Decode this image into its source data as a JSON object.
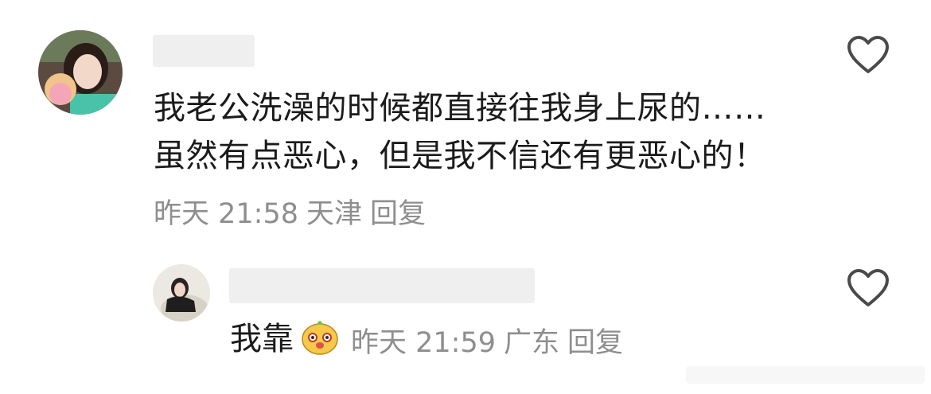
{
  "comment": {
    "text_line1": "我老公洗澡的时候都直接往我身上尿的……",
    "text_line2": "虽然有点恶心，但是我不信还有更恶心的！",
    "time": "昨天 21:58",
    "location": "天津",
    "reply_label": "回复"
  },
  "reply": {
    "text": "我靠",
    "emoji_icon": "cute-animal-emoji-icon",
    "time": "昨天 21:59",
    "location": "广东",
    "reply_label": "回复"
  },
  "icons": {
    "like": "heart-outline-icon"
  },
  "colors": {
    "text": "#1b1b1b",
    "meta": "#8e8e8e",
    "mask": "#efefef"
  }
}
